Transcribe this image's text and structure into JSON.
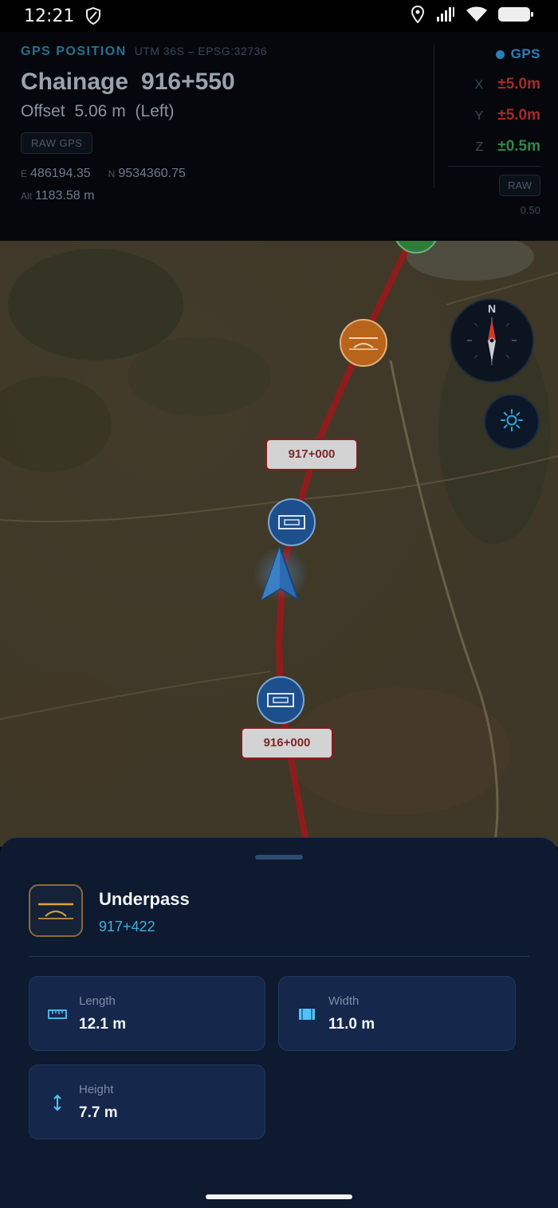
{
  "status_bar": {
    "time": "12:21"
  },
  "gps_header": {
    "section_title": "GPS POSITION",
    "crs": "UTM 36S – EPSG:32736",
    "chainage_label": "Chainage",
    "chainage_value": "916+550",
    "offset_label": "Offset",
    "offset_value": "5.06 m",
    "offset_side": "(Left)",
    "raw_gps_button": "RAW GPS",
    "easting_key": "E",
    "easting_value": "486194.35",
    "northing_key": "N",
    "northing_value": "9534360.75",
    "alt_key": "Alt",
    "alt_value": "1183.58 m",
    "gps_status": "GPS",
    "accuracy": [
      {
        "axis": "X",
        "value": "±5.0m",
        "color": "#a82a28"
      },
      {
        "axis": "Y",
        "value": "±5.0m",
        "color": "#a82a28"
      },
      {
        "axis": "Z",
        "value": "±0.5m",
        "color": "#2b8a4a"
      }
    ],
    "raw_button": "RAW",
    "raw_value": "0.50"
  },
  "map": {
    "chainage_labels": [
      "917+000",
      "916+000"
    ],
    "compass_north": "N",
    "colors": {
      "route": "#8f1c1c",
      "marker_orange": "#b8641a",
      "marker_blue": "#1d4f8c",
      "marker_green": "#2e7d3a"
    }
  },
  "feature": {
    "name": "Underpass",
    "chainage": "917+422",
    "icon": "underpass-icon",
    "cards": [
      {
        "label": "Length",
        "value": "12.1 m",
        "icon": "ruler-icon"
      },
      {
        "label": "Width",
        "value": "11.0 m",
        "icon": "width-icon"
      },
      {
        "label": "Height",
        "value": "7.7 m",
        "icon": "height-arrow-icon"
      }
    ]
  }
}
